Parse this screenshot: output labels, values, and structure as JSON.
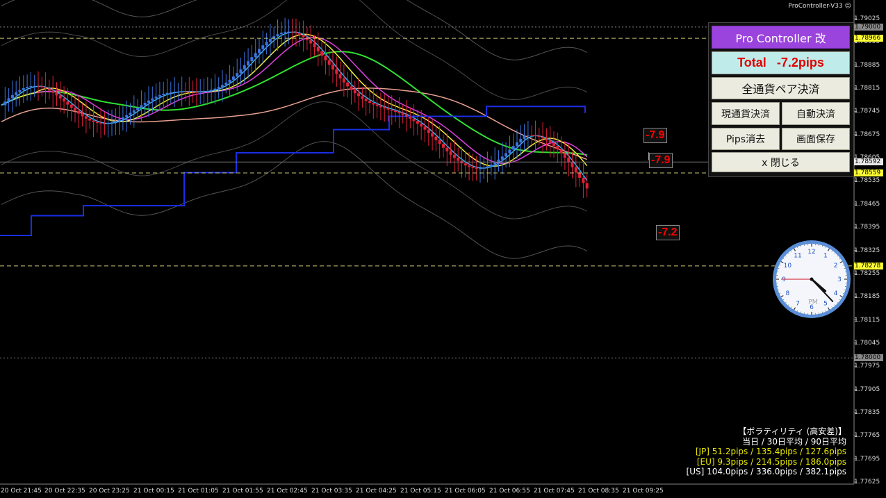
{
  "window": {
    "title": "ProController-V33"
  },
  "colors": {
    "background": "#000000",
    "bull": "#3b74e0",
    "bear": "#e0203a",
    "accent_purple": "#9a44dd",
    "total_bg": "#bfecea",
    "loss_red": "#ff0000",
    "label_yellow": "#ffff33"
  },
  "price_axis": {
    "ticks": [
      "1.79025",
      "1.78955",
      "1.78885",
      "1.78815",
      "1.78745",
      "1.78675",
      "1.78605",
      "1.78535",
      "1.78465",
      "1.78395",
      "1.78325",
      "1.78255",
      "1.78185",
      "1.78115",
      "1.78045",
      "1.77975",
      "1.77905",
      "1.77835",
      "1.77765",
      "1.77695",
      "1.77625"
    ],
    "markers": [
      {
        "value": "1.79000",
        "style": "grey"
      },
      {
        "value": "1.78966",
        "style": "yellow"
      },
      {
        "value": "1.78592",
        "style": "white"
      },
      {
        "value": "1.78559",
        "style": "yellow"
      },
      {
        "value": "1.78278",
        "style": "yellow"
      },
      {
        "value": "1.78000",
        "style": "grey"
      }
    ]
  },
  "time_axis": {
    "ticks": [
      "20 Oct 21:45",
      "20 Oct 22:35",
      "20 Oct 23:25",
      "21 Oct 00:15",
      "21 Oct 01:05",
      "21 Oct 01:55",
      "21 Oct 02:45",
      "21 Oct 03:35",
      "21 Oct 04:25",
      "21 Oct 05:15",
      "21 Oct 06:05",
      "21 Oct 06:55",
      "21 Oct 07:45",
      "21 Oct 08:35",
      "21 Oct 09:25"
    ]
  },
  "chart_data": {
    "type": "candlestick",
    "y_range": [
      1.7762,
      1.7904
    ],
    "x_range": [
      "20 Oct 21:45",
      "21 Oct 09:25"
    ],
    "grid": false,
    "horizontal_lines": [
      1.79,
      1.78966,
      1.78559,
      1.78278,
      1.78
    ],
    "current_price": 1.78592
  },
  "panel": {
    "title": "Pro Controller 改",
    "total_label": "Total",
    "total_value": "-7.2pips",
    "close_all_pairs": "全通貨ペア決済",
    "close_current": "現通貨決済",
    "auto_close": "自動決済",
    "erase_pips": "Pips消去",
    "save_screen": "画面保存",
    "close": "x 閉じる"
  },
  "pip_labels": [
    "-7.9",
    "-7.9",
    "-7.2"
  ],
  "clock": {
    "period": "PM",
    "hour": 4,
    "minute": 22,
    "second": 45
  },
  "volatility": {
    "title": "【ボラティリティ (高安差)】",
    "header": "当日 / 30日平均 / 90日平均",
    "rows": [
      {
        "text": "[JP] 51.2pips / 135.4pips / 127.6pips",
        "color": "#e8e800"
      },
      {
        "text": "[EU] 9.3pips / 214.5pips / 186.0pips",
        "color": "#e8e800"
      },
      {
        "text": "[US] 104.0pips / 336.0pips / 382.1pips",
        "color": "#ffffff"
      }
    ]
  }
}
